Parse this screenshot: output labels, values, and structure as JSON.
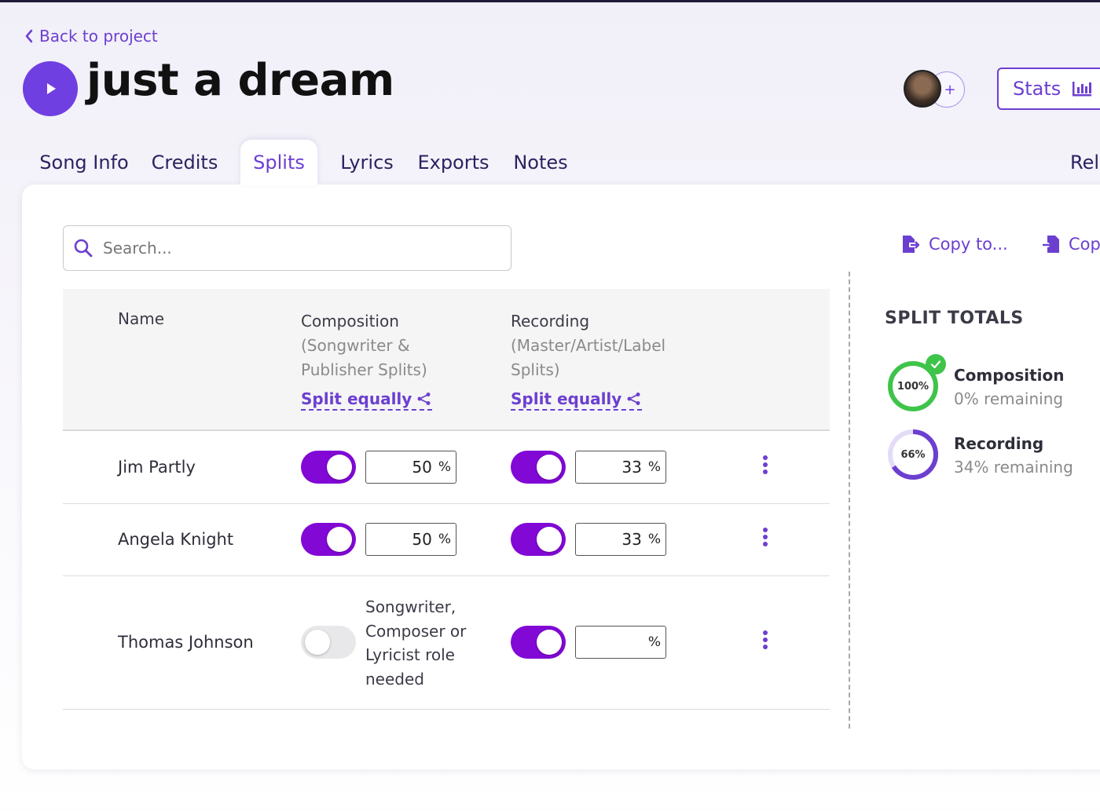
{
  "header": {
    "back_label": "Back to project",
    "song_title": "just a dream",
    "stats_label": "Stats",
    "add_collaborator": "+"
  },
  "tabs": [
    {
      "label": "Song Info",
      "active": false
    },
    {
      "label": "Credits",
      "active": false
    },
    {
      "label": "Splits",
      "active": true
    },
    {
      "label": "Lyrics",
      "active": false
    },
    {
      "label": "Exports",
      "active": false
    },
    {
      "label": "Notes",
      "active": false
    },
    {
      "label": "Rele",
      "active": false
    }
  ],
  "search": {
    "placeholder": "Search..."
  },
  "actions": {
    "copy_to": "Copy to...",
    "copy_from": "Cop"
  },
  "table": {
    "headers": {
      "name": "Name",
      "composition": "Composition",
      "composition_sub": "(Songwriter & Publisher Splits)",
      "recording": "Recording",
      "recording_sub": "(Master/Artist/Label Splits)",
      "split_equally": "Split equally"
    },
    "rows": [
      {
        "name": "Jim Partly",
        "composition_enabled": true,
        "composition_pct": "50",
        "recording_enabled": true,
        "recording_pct": "33",
        "unit": "%"
      },
      {
        "name": "Angela Knight",
        "composition_enabled": true,
        "composition_pct": "50",
        "recording_enabled": true,
        "recording_pct": "33",
        "unit": "%"
      },
      {
        "name": "Thomas Johnson",
        "composition_enabled": false,
        "composition_note": "Songwriter, Composer or Lyricist role needed",
        "recording_enabled": true,
        "recording_pct": "",
        "unit": "%"
      }
    ]
  },
  "split_totals": {
    "title": "SPLIT TOTALS",
    "items": [
      {
        "name": "Composition",
        "percent_label": "100%",
        "remaining": "0% remaining",
        "fraction": 1.0,
        "color": "#3fc44a",
        "complete": true
      },
      {
        "name": "Recording",
        "percent_label": "66%",
        "remaining": "34% remaining",
        "fraction": 0.66,
        "color": "#6c3fd0",
        "complete": false
      }
    ]
  },
  "colors": {
    "accent": "#6c3fd0",
    "toggle_on": "#8208d6",
    "success": "#3fc44a"
  }
}
